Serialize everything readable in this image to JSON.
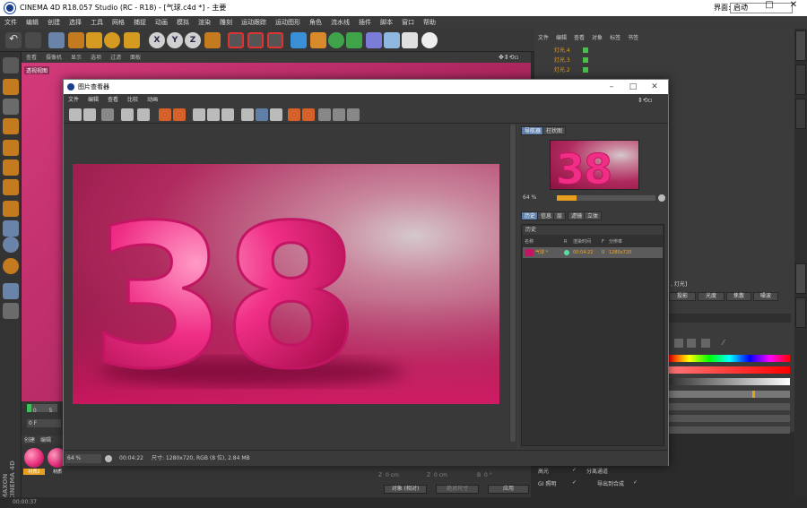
{
  "window": {
    "title": "CINEMA 4D R18.057 Studio (RC - R18) - [气球.c4d *] - 主要",
    "layout_label": "界面:",
    "layout_value": "启动"
  },
  "menubar": [
    "文件",
    "编辑",
    "创建",
    "选择",
    "工具",
    "网格",
    "捕捉",
    "动画",
    "模拟",
    "渲染",
    "雕刻",
    "运动跟踪",
    "运动图形",
    "角色",
    "流水线",
    "插件",
    "脚本",
    "窗口",
    "帮助"
  ],
  "viewport": {
    "menu": [
      "查看",
      "摄像机",
      "显示",
      "选项",
      "过滤",
      "面板"
    ],
    "label": "透视视图"
  },
  "object_manager": {
    "menu": [
      "文件",
      "编辑",
      "查看",
      "对象",
      "标签",
      "书签"
    ],
    "rows": [
      "灯光.4",
      "灯光.3",
      "灯光.2"
    ]
  },
  "picture_viewer": {
    "title": "图片查看器",
    "menu": [
      "文件",
      "编辑",
      "查看",
      "比较",
      "动画"
    ],
    "tabs_top": [
      "导航器",
      "柱状图"
    ],
    "zoom": "64 %",
    "tabs_mid": [
      "历史",
      "信息",
      "层",
      "滤镜",
      "立体"
    ],
    "history_header": "历史",
    "columns": [
      "名称",
      "R",
      "渲染时间",
      "F",
      "分辨率"
    ],
    "history_row": {
      "name": "气球 *",
      "time": "00:04:22",
      "frame": "0",
      "res": "1280x720"
    },
    "bottom": {
      "zoom": "64 %",
      "time": "00:04:22",
      "info": "尺寸: 1280x720, RGB (8 位), 2.84 MB"
    },
    "render_text": "38"
  },
  "attributes": {
    "header": ", 灯光]",
    "tabs": [
      "投影",
      "光度",
      "焦散",
      "噪波"
    ]
  },
  "timeline": {
    "frame1": "0",
    "frame2": "5",
    "frame3": "0 F"
  },
  "material_manager": {
    "menu": [
      "创建",
      "编辑"
    ],
    "materials": [
      "材质2",
      "材质"
    ]
  },
  "coords": {
    "z1": "Z",
    "z1v": "0 cm",
    "z2": "Z",
    "z2v": "0 cm",
    "b": "B",
    "bv": "0 °",
    "mode": "对象 (相对)",
    "size": "绝对尺寸",
    "apply": "应用"
  },
  "render_opts": {
    "o1": "高光",
    "o2": "分离通道",
    "o3": "GI 照明",
    "o4": "导出到合成"
  },
  "status": "00:00:37",
  "colors": {
    "accent": "#5f7fa8",
    "render_pink": "#e8307c"
  }
}
